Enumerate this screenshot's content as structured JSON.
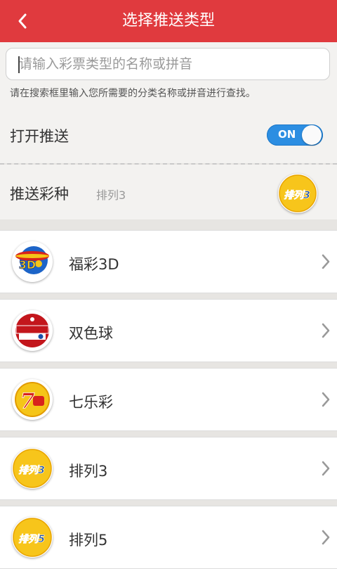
{
  "header": {
    "title": "选择推送类型",
    "back_icon": "chevron-left-icon"
  },
  "search": {
    "placeholder": "请输入彩票类型的名称或拼音",
    "value": "",
    "hint": "请在搜索框里输入您所需要的分类名称或拼音进行查找。"
  },
  "push": {
    "label": "打开推送",
    "toggle_text": "ON",
    "enabled": true
  },
  "push_type": {
    "label": "推送彩种",
    "selected": "排列3",
    "logo_text": "排列3"
  },
  "lotteries": [
    {
      "name": "福彩3D",
      "logo": "fucai-3d-logo"
    },
    {
      "name": "双色球",
      "logo": "shuangseqiu-logo"
    },
    {
      "name": "七乐彩",
      "logo": "qilecai-logo"
    },
    {
      "name": "排列3",
      "logo": "pailie3-logo",
      "logo_text": "排列3"
    },
    {
      "name": "排列5",
      "logo": "pailie5-logo",
      "logo_text": "排列5"
    }
  ],
  "colors": {
    "header_bg": "#e03a3e",
    "toggle_on": "#2c8ee2",
    "logo_yellow": "#f5c518",
    "logo_red": "#d8231c",
    "logo_blue": "#1a4fa8"
  }
}
